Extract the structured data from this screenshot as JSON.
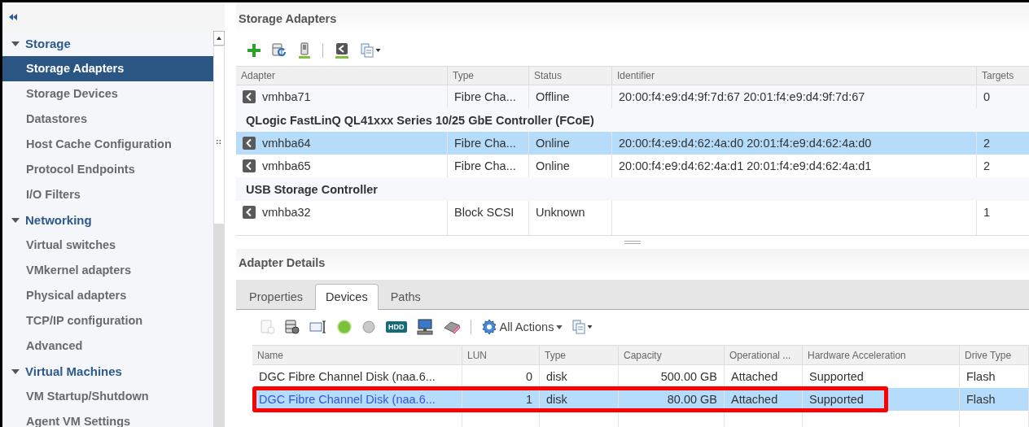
{
  "sidebar": {
    "sections": [
      {
        "label": "Storage",
        "expanded": true,
        "items": [
          {
            "label": "Storage Adapters",
            "selected": true
          },
          {
            "label": "Storage Devices",
            "selected": false
          },
          {
            "label": "Datastores",
            "selected": false
          },
          {
            "label": "Host Cache Configuration",
            "selected": false
          },
          {
            "label": "Protocol Endpoints",
            "selected": false
          },
          {
            "label": "I/O Filters",
            "selected": false
          }
        ]
      },
      {
        "label": "Networking",
        "expanded": true,
        "items": [
          {
            "label": "Virtual switches",
            "selected": false
          },
          {
            "label": "VMkernel adapters",
            "selected": false
          },
          {
            "label": "Physical adapters",
            "selected": false
          },
          {
            "label": "TCP/IP configuration",
            "selected": false
          },
          {
            "label": "Advanced",
            "selected": false
          }
        ]
      },
      {
        "label": "Virtual Machines",
        "expanded": true,
        "items": [
          {
            "label": "VM Startup/Shutdown",
            "selected": false
          },
          {
            "label": "Agent VM Settings",
            "selected": false
          }
        ]
      }
    ]
  },
  "adapters": {
    "title": "Storage Adapters",
    "columns": [
      "Adapter",
      "Type",
      "Status",
      "Identifier",
      "Targets"
    ],
    "rows": [
      {
        "kind": "adapter",
        "selected": false,
        "cells": [
          "vmhba71",
          "Fibre Cha...",
          "Offline",
          "20:00:f4:e9:d4:9f:7d:67 20:01:f4:e9:d4:9f:7d:67",
          "0"
        ]
      },
      {
        "kind": "group",
        "label": "QLogic FastLinQ QL41xxx Series 10/25 GbE Controller (FCoE)"
      },
      {
        "kind": "adapter",
        "selected": true,
        "cells": [
          "vmhba64",
          "Fibre Cha...",
          "Online",
          "20:00:f4:e9:d4:62:4a:d0 20:01:f4:e9:d4:62:4a:d0",
          "2"
        ]
      },
      {
        "kind": "adapter",
        "selected": false,
        "cells": [
          "vmhba65",
          "Fibre Cha...",
          "Online",
          "20:00:f4:e9:d4:62:4a:d1 20:01:f4:e9:d4:62:4a:d1",
          "2"
        ]
      },
      {
        "kind": "group",
        "label": "USB Storage Controller"
      },
      {
        "kind": "adapter",
        "selected": false,
        "cells": [
          "vmhba32",
          "Block SCSI",
          "Unknown",
          "",
          "1"
        ]
      }
    ]
  },
  "details": {
    "title": "Adapter Details",
    "tabs": [
      {
        "label": "Properties",
        "selected": false
      },
      {
        "label": "Devices",
        "selected": true
      },
      {
        "label": "Paths",
        "selected": false
      }
    ],
    "hdd_badge": "HDD",
    "actions_label": "All Actions",
    "columns": [
      "Name",
      "LUN",
      "Type",
      "Capacity",
      "Operational ...",
      "Hardware Acceleration",
      "Drive Type"
    ],
    "rows": [
      {
        "selected": false,
        "highlighted": false,
        "cells": [
          "DGC Fibre Channel Disk (naa.6...",
          "0",
          "disk",
          "500.00 GB",
          "Attached",
          "Supported",
          "Flash"
        ]
      },
      {
        "selected": true,
        "highlighted": true,
        "cells": [
          "DGC Fibre Channel Disk (naa.6...",
          "1",
          "disk",
          "80.00 GB",
          "Attached",
          "Supported",
          "Flash"
        ]
      }
    ]
  }
}
